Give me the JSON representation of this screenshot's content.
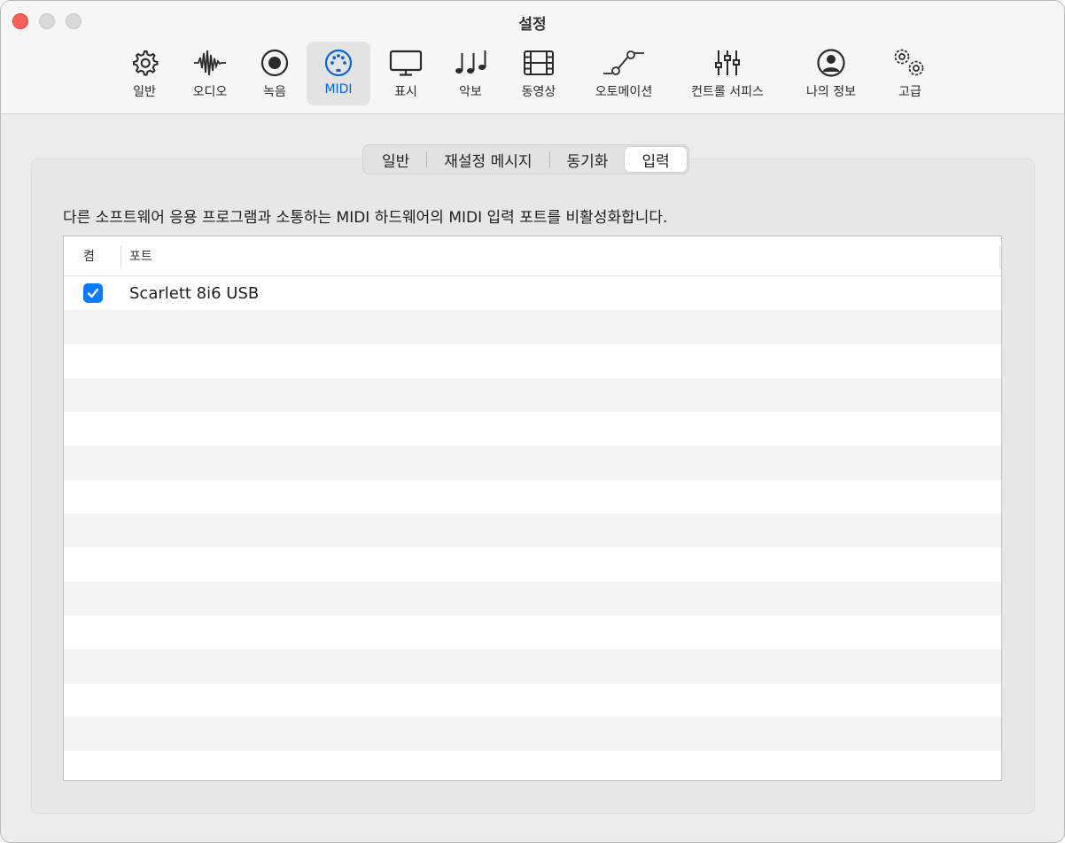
{
  "window": {
    "title": "설정"
  },
  "toolbar": {
    "items": [
      {
        "label": "일반",
        "icon": "gear-icon"
      },
      {
        "label": "오디오",
        "icon": "waveform-icon"
      },
      {
        "label": "녹음",
        "icon": "record-icon"
      },
      {
        "label": "MIDI",
        "icon": "midi-connector-icon",
        "active": true
      },
      {
        "label": "표시",
        "icon": "display-icon"
      },
      {
        "label": "악보",
        "icon": "music-notes-icon"
      },
      {
        "label": "동영상",
        "icon": "film-icon"
      },
      {
        "label": "오토메이션",
        "icon": "automation-curve-icon"
      },
      {
        "label": "컨트롤 서피스",
        "icon": "sliders-icon"
      },
      {
        "label": "나의 정보",
        "icon": "person-circle-icon"
      },
      {
        "label": "고급",
        "icon": "gears-icon"
      }
    ]
  },
  "tabs": {
    "items": [
      "일반",
      "재설정 메시지",
      "동기화",
      "입력"
    ],
    "selected": "입력"
  },
  "description": "다른 소프트웨어 응용 프로그램과 소통하는 MIDI 하드웨어의 MIDI 입력 포트를 비활성화합니다.",
  "table": {
    "columns": {
      "on": "켬",
      "port": "포트"
    },
    "rows": [
      {
        "on": true,
        "port": "Scarlett 8i6 USB"
      }
    ]
  },
  "colors": {
    "accent": "#0a7aff",
    "active_label": "#0a64d8",
    "close_button": "#fe5f57"
  }
}
